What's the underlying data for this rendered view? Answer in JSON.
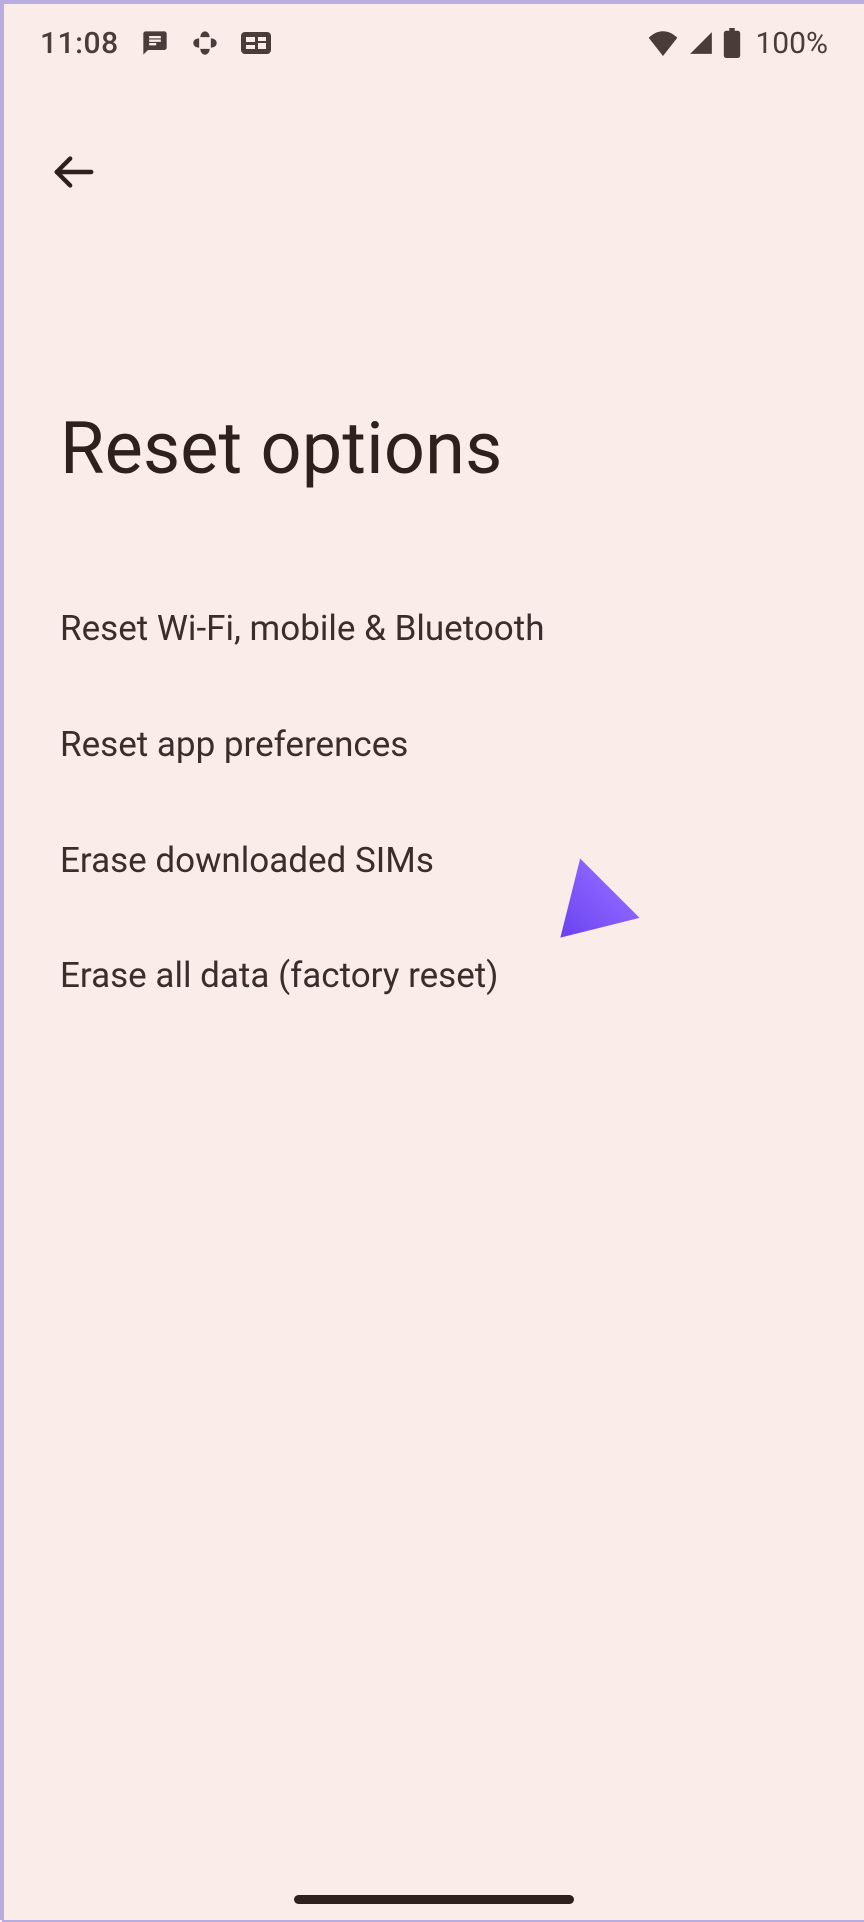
{
  "status_bar": {
    "time": "11:08",
    "battery_text": "100%"
  },
  "toolbar": {
    "back_aria": "Back"
  },
  "page": {
    "title": "Reset options"
  },
  "options": [
    {
      "label": "Reset Wi-Fi, mobile & Bluetooth"
    },
    {
      "label": "Reset app preferences"
    },
    {
      "label": "Erase downloaded SIMs"
    },
    {
      "label": "Erase all data (factory reset)"
    }
  ],
  "annotation": {
    "arrow_color": "#7a52ff",
    "target_option_index": 3
  }
}
